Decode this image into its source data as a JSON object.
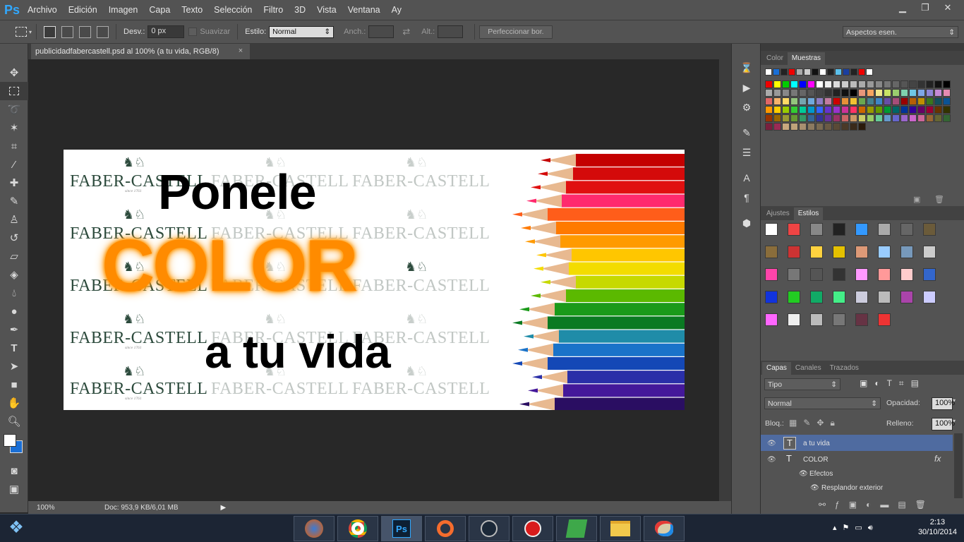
{
  "app": {
    "logo": "Ps"
  },
  "menu": [
    "Archivo",
    "Edición",
    "Imagen",
    "Capa",
    "Texto",
    "Selección",
    "Filtro",
    "3D",
    "Vista",
    "Ventana",
    "Ay"
  ],
  "options": {
    "desv_label": "Desv.:",
    "desv_value": "0 px",
    "suavizar_label": "Suavizar",
    "estilo_label": "Estilo:",
    "estilo_value": "Normal",
    "anch_label": "Anch.:",
    "alt_label": "Alt.:",
    "refine_button": "Perfeccionar bor.",
    "workspace": "Aspectos esen."
  },
  "document": {
    "tab_title": "publicidadfabercastell.psd al 100% (a tu vida, RGB/8)",
    "close": "×",
    "zoom": "100%",
    "doc_info": "Doc: 953,9 KB/6,01 MB"
  },
  "artwork": {
    "line1": "Ponele",
    "line2": "COLOR",
    "line3": "a tu vida",
    "brand": "FABER-CASTELL",
    "brand_sub": "since 1761",
    "accent": "#ff8b00"
  },
  "panels": {
    "color_tabs": [
      "Color",
      "Muestras"
    ],
    "adjust_tabs": [
      "Ajustes",
      "Estilos"
    ],
    "layer_tabs": [
      "Capas",
      "Canales",
      "Trazados"
    ],
    "filter_kind": "Tipo",
    "blend_mode": "Normal",
    "opacity_label": "Opacidad:",
    "opacity_value": "100%",
    "lock_label": "Bloq.:",
    "fill_label": "Relleno:",
    "fill_value": "100%",
    "layers": [
      {
        "name": "a tu vida",
        "type": "T"
      },
      {
        "name": "COLOR",
        "type": "T",
        "fx": "fx"
      }
    ],
    "effects_label": "Efectos",
    "effect_name": "Resplandor exterior"
  },
  "taskbar": {
    "time": "2:13",
    "date": "30/10/2014"
  }
}
